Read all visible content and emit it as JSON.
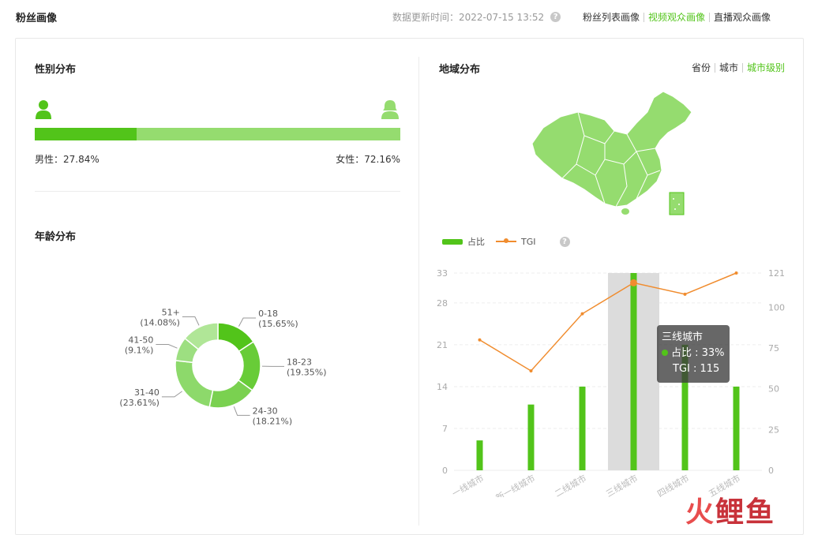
{
  "header": {
    "title": "粉丝画像",
    "update_text": "数据更新时间：2022-07-15 13:52",
    "view_tabs": [
      "粉丝列表画像",
      "视频观众画像",
      "直播观众画像"
    ]
  },
  "gender": {
    "title": "性别分布",
    "male_label": "男性：27.84%",
    "female_label": "女性：72.16%",
    "male_ratio": 0.2784
  },
  "age": {
    "title": "年龄分布",
    "chart_data": {
      "type": "pie",
      "categories": [
        "0-18",
        "18-23",
        "24-30",
        "31-40",
        "41-50",
        "51+"
      ],
      "values": [
        15.65,
        19.35,
        18.21,
        23.61,
        9.1,
        14.08
      ],
      "labels": [
        "(15.65%)",
        "(19.35%)",
        "(18.21%)",
        "(23.61%)",
        "(9.1%)",
        "(14.08%)"
      ],
      "colors": [
        "#52c41a",
        "#68cc38",
        "#7ad150",
        "#8dd96b",
        "#9ddf81",
        "#b0e697"
      ]
    }
  },
  "region": {
    "title": "地域分布",
    "tabs": [
      "省份",
      "城市",
      "城市级别"
    ],
    "legend": {
      "share": "占比",
      "tgi": "TGI"
    },
    "chart_data": {
      "type": "bar",
      "categories": [
        "一线城市",
        "新一线城市",
        "二线城市",
        "三线城市",
        "四线城市",
        "五线城市"
      ],
      "series": [
        {
          "name": "占比",
          "values": [
            5,
            11,
            14,
            33,
            21,
            14
          ]
        },
        {
          "name": "TGI",
          "values": [
            80,
            61,
            96,
            115,
            108,
            121
          ]
        }
      ],
      "y_left": {
        "ticks": [
          0,
          7,
          14,
          21,
          28,
          33
        ],
        "range": [
          0,
          33
        ]
      },
      "y_right": {
        "ticks": [
          0,
          25,
          50,
          75,
          100,
          121
        ],
        "range": [
          0,
          121
        ]
      }
    },
    "tooltip": {
      "title": "三线城市",
      "share": "占比 : 33%",
      "tgi": "TGI : 115"
    }
  },
  "watermark": {
    "part1": "火",
    "part2": "鲤鱼"
  }
}
